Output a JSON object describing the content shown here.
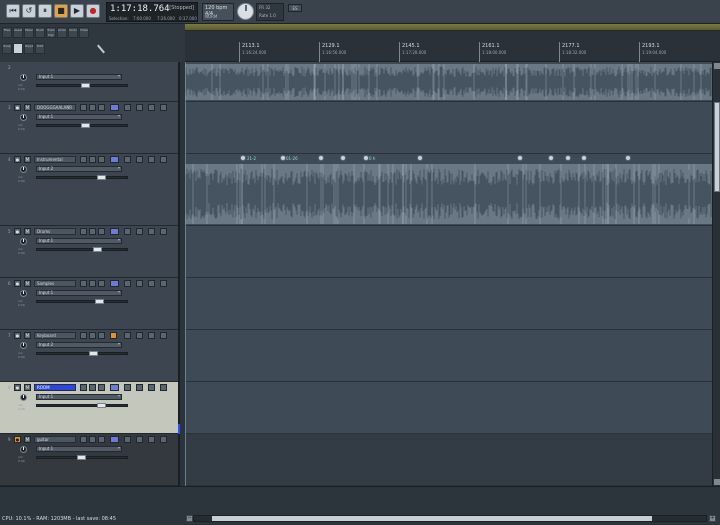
{
  "transport": {
    "buttons": [
      {
        "name": "go-to-start-icon",
        "glyph": "⏮"
      },
      {
        "name": "loop-icon",
        "glyph": "↺"
      },
      {
        "name": "pause-icon",
        "glyph": "⏸"
      },
      {
        "name": "stop-icon",
        "glyph": "■"
      },
      {
        "name": "play-icon",
        "glyph": "▶"
      },
      {
        "name": "record-icon",
        "glyph": "●"
      }
    ],
    "time": "1:17:18.764",
    "state": "[Stopped]",
    "sel_label": "Selection:",
    "sel_start": "7:00.000",
    "sel_end": "7:26.000",
    "sel_len": "0:37.000"
  },
  "tempo": {
    "label": "120 bpm 4/4",
    "sub": "NORM"
  },
  "meters": {
    "top": "FR    32",
    "bottom": "Rate  1.0",
    "extra": "ES"
  },
  "tools": [
    "Files",
    "Assets",
    "Mixer",
    "Routing",
    "Track Mgr",
    "Actions",
    "Undo",
    "Video",
    "Snap",
    "Grid",
    "Ripple",
    "Edit"
  ],
  "ruler": {
    "ticks": [
      {
        "bar": "2113.1",
        "time": "1:16:24.000"
      },
      {
        "bar": "2129.1",
        "time": "1:16:56.000"
      },
      {
        "bar": "2145.1",
        "time": "1:17:28.000"
      },
      {
        "bar": "2161.1",
        "time": "1:18:00.000"
      },
      {
        "bar": "2177.1",
        "time": "1:18:32.000"
      },
      {
        "bar": "2193.1",
        "time": "1:19:04.000"
      }
    ]
  },
  "tracks": [
    {
      "num": "2",
      "name": "",
      "input": "Input 1"
    },
    {
      "num": "3",
      "name": "DOOGGGAALANR",
      "input": "Input 1"
    },
    {
      "num": "4",
      "name": "Instrumental",
      "input": "Input 2"
    },
    {
      "num": "5",
      "name": "Drums",
      "input": "Input 1"
    },
    {
      "num": "6",
      "name": "Samples",
      "input": "Input 1"
    },
    {
      "num": "7",
      "name": "Keyboard",
      "input": "Input 2"
    },
    {
      "num": "8",
      "name": "ROOM",
      "input": "Input 1"
    },
    {
      "num": "9",
      "name": "guitar",
      "input": "Input 1"
    }
  ],
  "markers": [
    "21-2",
    "01-26",
    "0 h"
  ],
  "status": "CPU: 10.1% - RAM: 1203MB - last save: 08:45"
}
